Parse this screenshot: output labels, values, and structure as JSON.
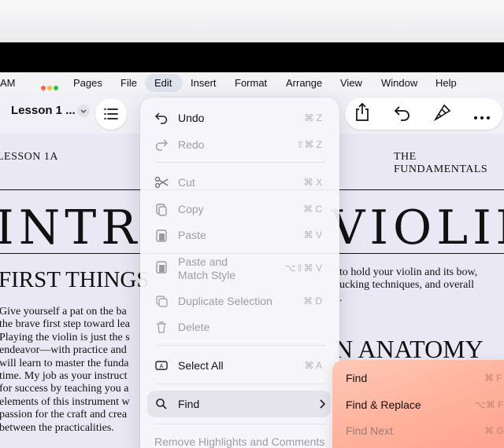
{
  "menubar": {
    "clock": "AM",
    "items": [
      "Pages",
      "File",
      "Edit",
      "Insert",
      "Format",
      "Arrange",
      "View",
      "Window",
      "Help"
    ],
    "dot_colors": [
      "#ff5f57",
      "#febc2e",
      "#28c840"
    ]
  },
  "toolbar": {
    "doc_title": "Lesson 1 ...",
    "icons": [
      "chevron-down-icon",
      "list-icon",
      "share-icon",
      "undo-icon",
      "paintbrush-icon",
      "more-icon"
    ]
  },
  "document": {
    "header_left": "LESSON 1A",
    "header_right": "THE FUNDAMENTALS",
    "title_left": "INTR",
    "title_right": "VIOLIN",
    "subheading": "FIRST THINGS",
    "body_left": [
      "Give yourself a pat on the ba",
      "the brave first step toward lea",
      "Playing the violin is just the s",
      "endeavor—with practice and",
      "will learn to master the funda",
      "time. My job as your instruct",
      "for success by teaching you a",
      "elements of this instrument w",
      "passion for the craft and crea",
      "between the practicalities."
    ],
    "body_right": [
      "to hold your violin and its bow,",
      "ucking techniques, and overall",
      "."
    ],
    "section_heading": "N ANATOMY"
  },
  "edit_menu": {
    "items": [
      {
        "label": "Undo",
        "shortcut": "⌘ Z",
        "icon": "undo-icon",
        "enabled": true
      },
      {
        "label": "Redo",
        "shortcut": "⇧⌘ Z",
        "icon": "redo-icon",
        "enabled": false
      },
      {
        "label": "Cut",
        "shortcut": "⌘ X",
        "icon": "scissors-icon",
        "enabled": false
      },
      {
        "label": "Copy",
        "shortcut": "⌘ C",
        "icon": "copy-icon",
        "enabled": false
      },
      {
        "label": "Paste",
        "shortcut": "⌘ V",
        "icon": "paste-icon",
        "enabled": false
      },
      {
        "label": "Paste and",
        "label2": "Match Style",
        "shortcut": "⌥⇧⌘ V",
        "icon": "paste-style-icon",
        "enabled": false
      },
      {
        "label": "Duplicate Selection",
        "shortcut": "⌘ D",
        "icon": "duplicate-icon",
        "enabled": false
      },
      {
        "label": "Delete",
        "shortcut": "",
        "icon": "trash-icon",
        "enabled": false
      },
      {
        "label": "Select All",
        "shortcut": "⌘ A",
        "icon": "select-all-icon",
        "enabled": true
      },
      {
        "label": "Find",
        "shortcut": "",
        "icon": "search-icon",
        "enabled": true
      },
      {
        "label": "Remove Highlights and Comments",
        "shortcut": "",
        "icon": "",
        "enabled": false
      }
    ]
  },
  "find_submenu": {
    "items": [
      {
        "label": "Find",
        "shortcut": "⌘ F",
        "enabled": true
      },
      {
        "label": "Find & Replace",
        "shortcut": "⌥⌘ F",
        "enabled": true
      },
      {
        "label": "Find Next",
        "shortcut": "⌘ G",
        "enabled": false
      }
    ]
  },
  "colors": {
    "submenu_accent": "#ffb39e",
    "page_bg": "#eae8f4"
  }
}
